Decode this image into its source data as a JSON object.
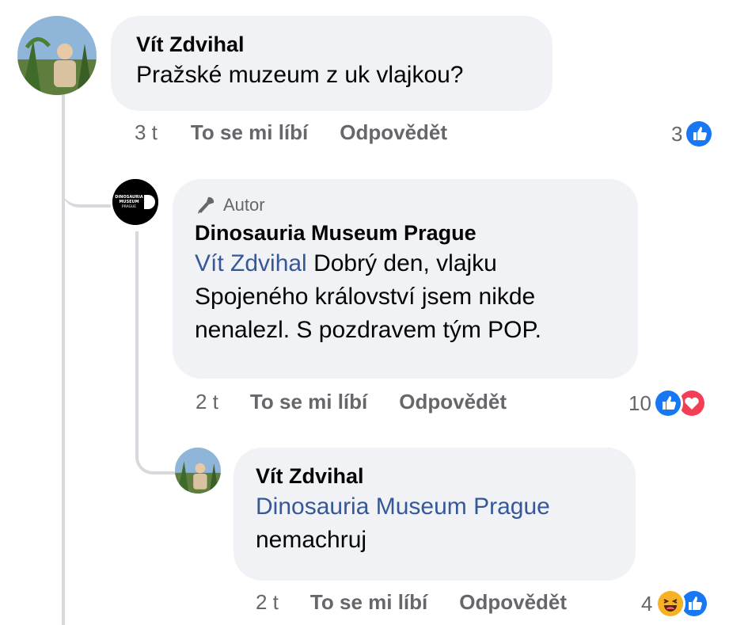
{
  "comments": [
    {
      "author": "Vít Zdvihal",
      "text": "Pražské muzeum z uk vlajkou?",
      "time": "3 t",
      "like_label": "To se mi líbí",
      "reply_label": "Odpovědět",
      "reaction_count": "3",
      "reactions": [
        "like-icon"
      ]
    },
    {
      "author_badge": "Autor",
      "author": "Dinosauria Museum Prague",
      "mention": "Vít Zdvihal",
      "text_lines": [
        " Dobrý den, vlajku",
        "Spojeného království jsem nikde",
        "nenalezl. S pozdravem tým POP."
      ],
      "time": "2 t",
      "like_label": "To se mi líbí",
      "reply_label": "Odpovědět",
      "reaction_count": "10",
      "reactions": [
        "like-icon",
        "love-icon"
      ]
    },
    {
      "author": "Vít Zdvihal",
      "mention": "Dinosauria Museum Prague",
      "text": "nemachruj",
      "time": "2 t",
      "like_label": "To se mi líbí",
      "reply_label": "Odpovědět",
      "reaction_count": "4",
      "reactions": [
        "haha-icon",
        "like-icon"
      ]
    }
  ],
  "colors": {
    "bubble": "#f0f2f5",
    "mention": "#365899",
    "meta": "#65676b",
    "like": "#1877f2",
    "love": "#f33e58",
    "haha": "#f7b125"
  }
}
